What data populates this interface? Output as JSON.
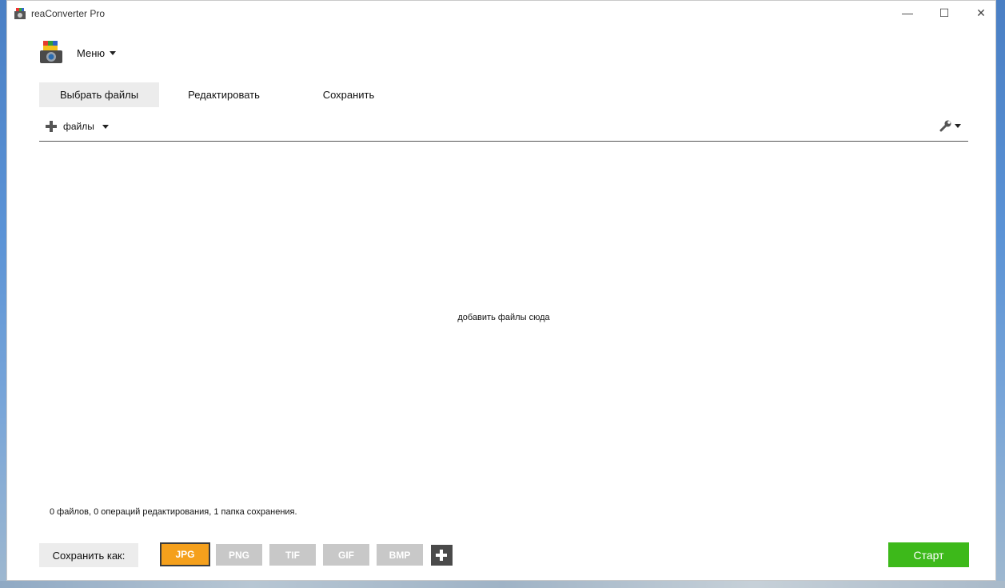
{
  "window": {
    "title": "reaConverter Pro"
  },
  "controls": {
    "minimize": "—",
    "maximize": "☐",
    "close": "✕"
  },
  "menu": {
    "label": "Меню"
  },
  "tabs": [
    {
      "label": "Выбрать файлы",
      "active": true
    },
    {
      "label": "Редактировать",
      "active": false
    },
    {
      "label": "Сохранить",
      "active": false
    }
  ],
  "toolbar": {
    "add_files_label": "файлы"
  },
  "dropzone": {
    "hint": "добавить файлы сюда"
  },
  "status": {
    "text": "0 файлов, 0 операций редактирования, 1 папка сохранения."
  },
  "save_as": {
    "label": "Сохранить как:",
    "formats": [
      "JPG",
      "PNG",
      "TIF",
      "GIF",
      "BMP"
    ],
    "selected": "JPG"
  },
  "start": {
    "label": "Старт"
  },
  "colors": {
    "accent_orange": "#f5a01c",
    "start_green": "#3db91a",
    "inactive_format": "#c8c8c8"
  },
  "icons": [
    "app-icon",
    "logo-icon",
    "chevron-down-icon",
    "plus-icon",
    "wrench-icon"
  ]
}
